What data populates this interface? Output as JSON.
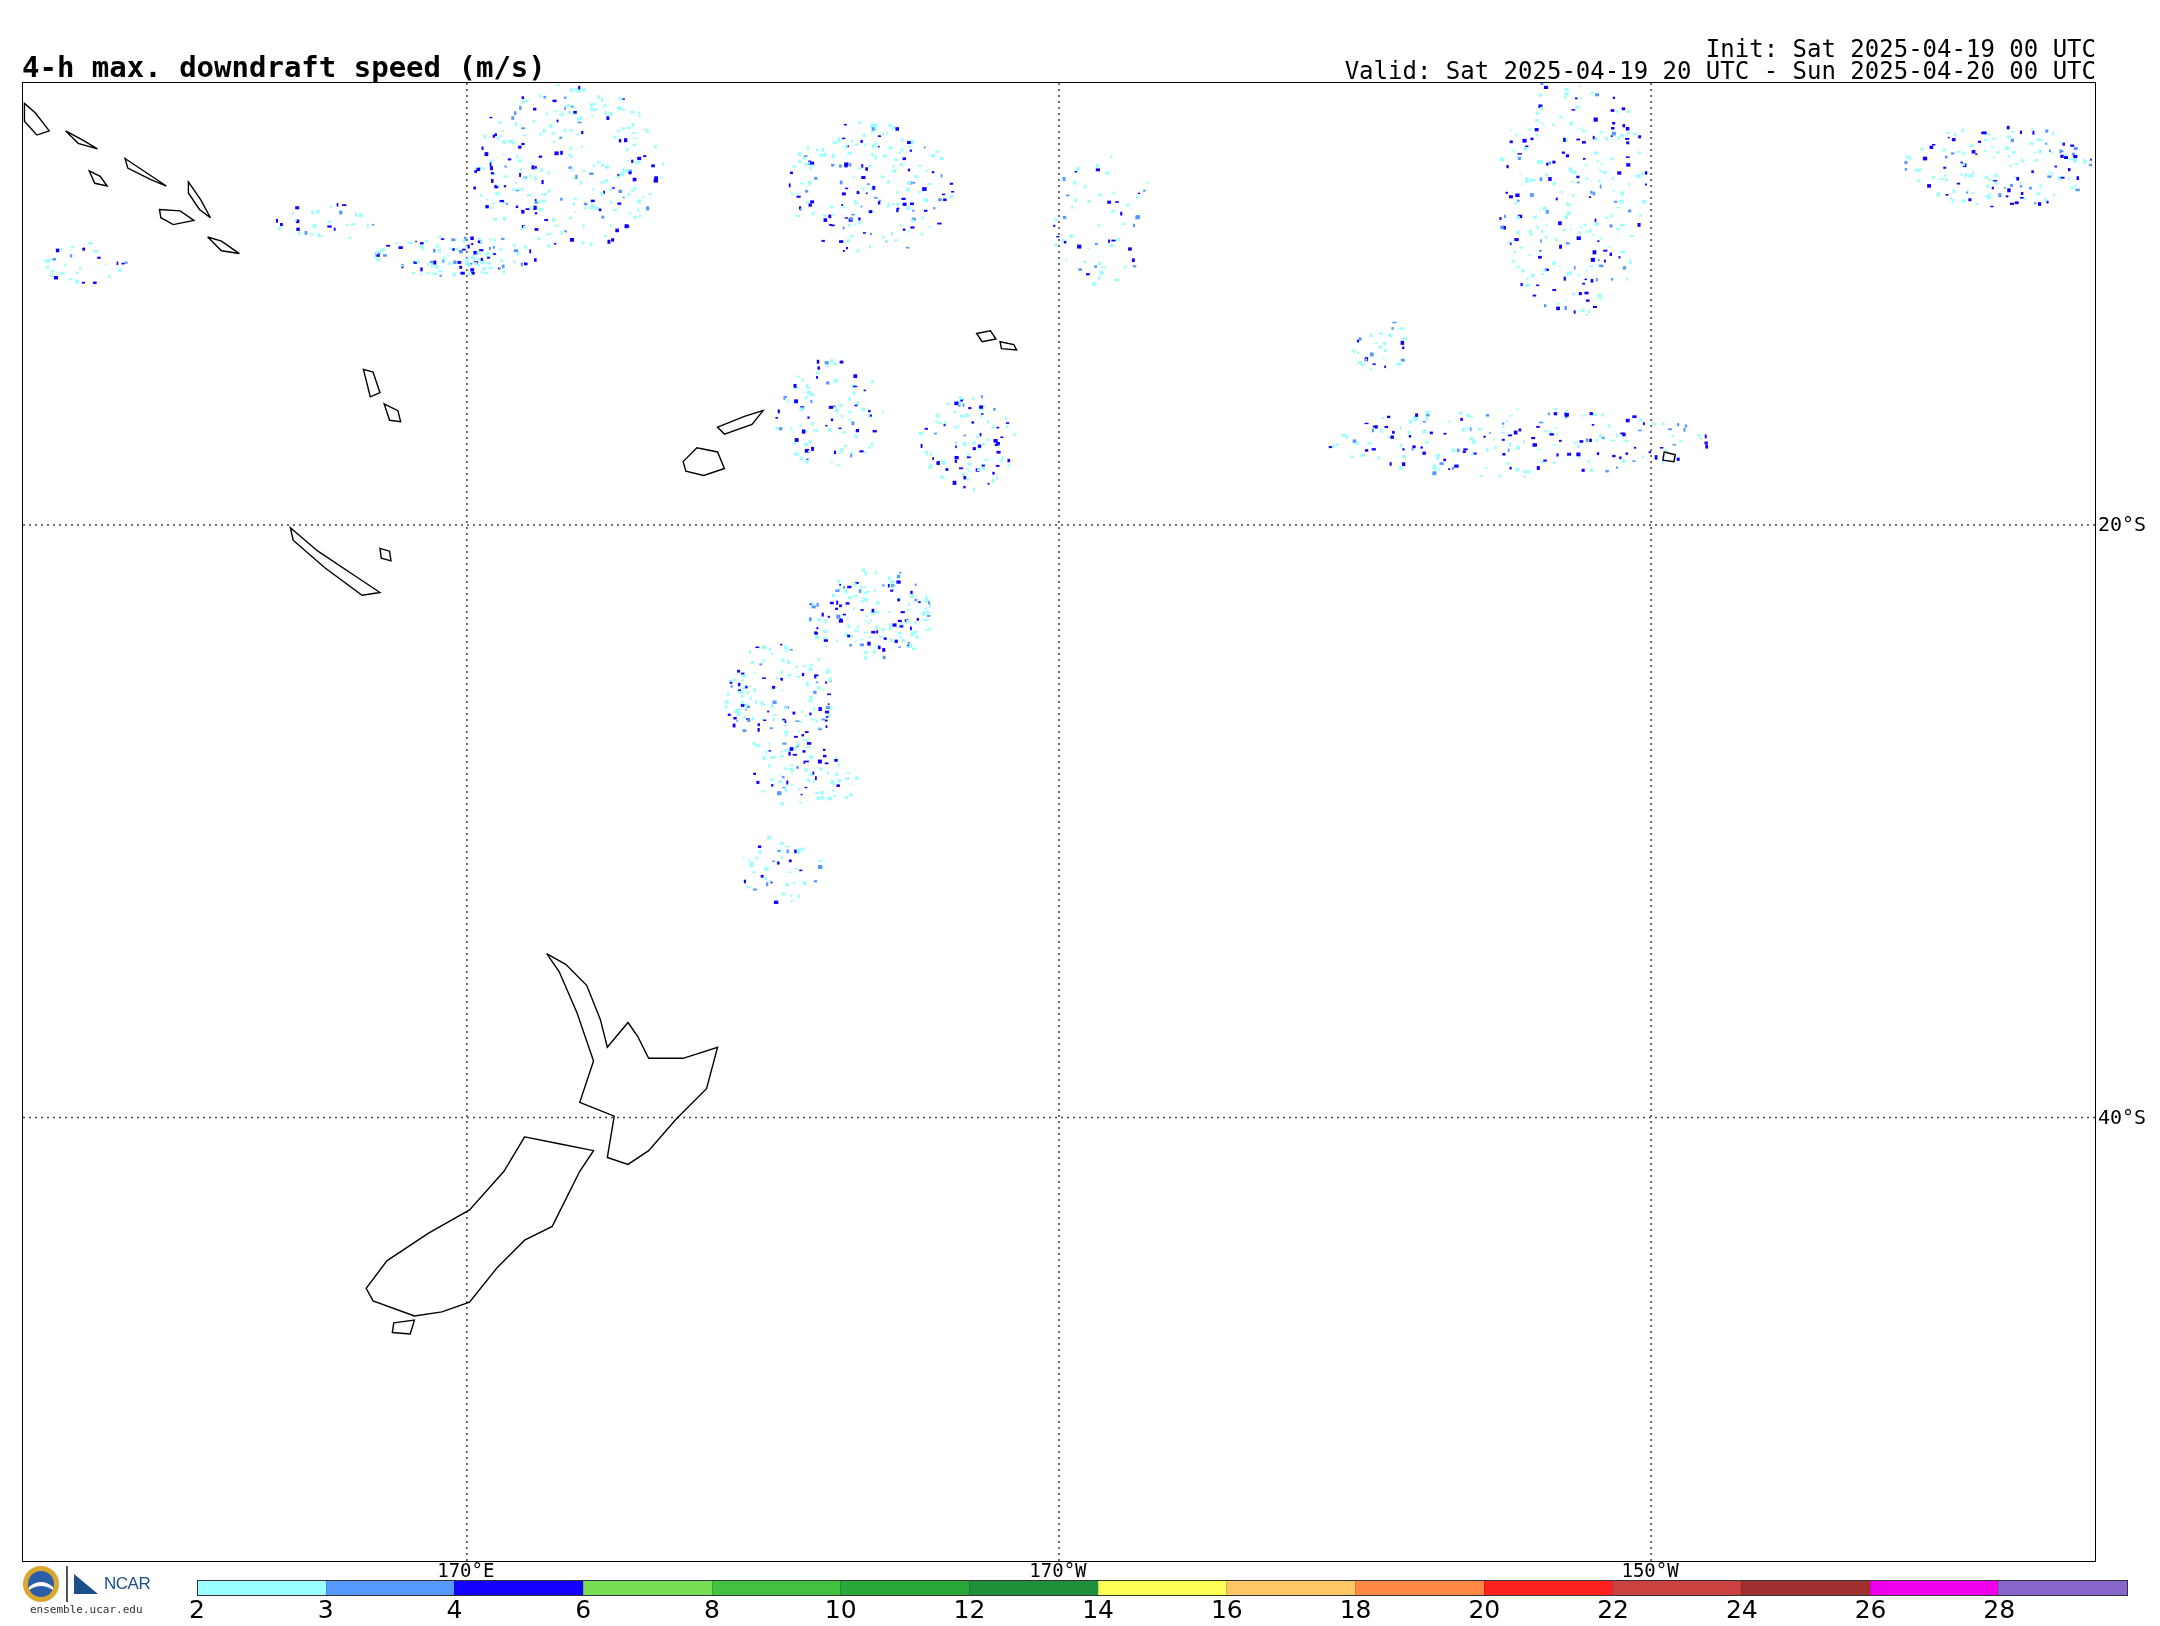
{
  "header": {
    "title": "4-h max. downdraft speed (m/s)",
    "init": "Init: Sat 2025-04-19 00 UTC",
    "valid": "Valid: Sat 2025-04-19 20 UTC - Sun 2025-04-20 00 UTC"
  },
  "map": {
    "longitude_labels": [
      "170°E",
      "170°W",
      "150°W"
    ],
    "latitude_labels": [
      "20°S",
      "40°S"
    ]
  },
  "logo": {
    "text": "NCAR",
    "site": "ensemble.ucar.edu"
  },
  "colorbar": {
    "bins": [
      {
        "color": "#99ffff"
      },
      {
        "color": "#5599ff"
      },
      {
        "color": "#1100ff"
      },
      {
        "color": "#77dd55"
      },
      {
        "color": "#44c040"
      },
      {
        "color": "#2aa83a"
      },
      {
        "color": "#1f8f3a"
      },
      {
        "color": "#ffff55"
      },
      {
        "color": "#ffc864"
      },
      {
        "color": "#ff8844"
      },
      {
        "color": "#ff2020"
      },
      {
        "color": "#cc4040"
      },
      {
        "color": "#a03030"
      },
      {
        "color": "#ee00ee"
      },
      {
        "color": "#8866cc"
      }
    ],
    "ticks": [
      "2",
      "3",
      "4",
      "6",
      "8",
      "10",
      "12",
      "14",
      "16",
      "18",
      "20",
      "22",
      "24",
      "26",
      "28"
    ]
  }
}
